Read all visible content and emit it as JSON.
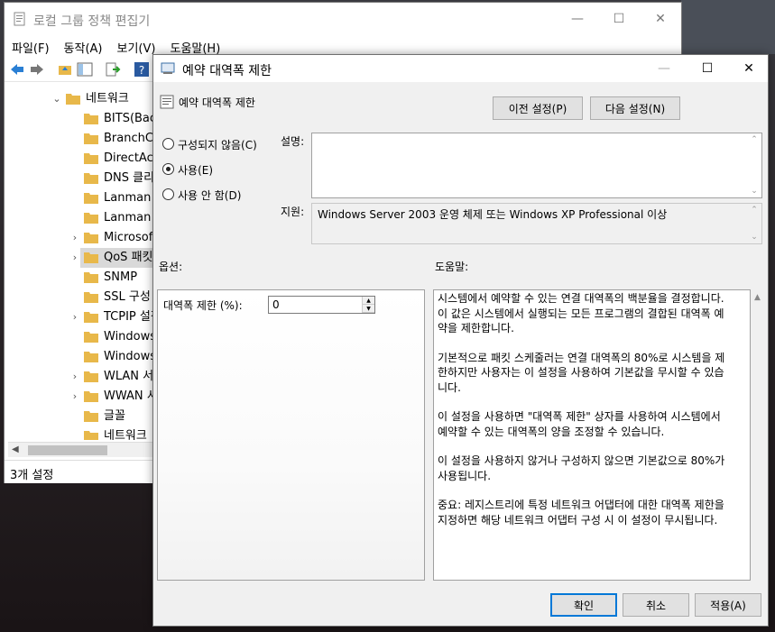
{
  "back_window": {
    "title": "로컬 그룹 정책 편집기",
    "controls": {
      "minimize": "—",
      "maximize": "☐",
      "close": "✕"
    },
    "menu": [
      "파일(F)",
      "동작(A)",
      "보기(V)",
      "도움말(H)"
    ],
    "tree": {
      "root_label": "네트워크",
      "items": [
        {
          "label": "BITS(Back",
          "expandable": false
        },
        {
          "label": "BranchCa",
          "expandable": false
        },
        {
          "label": "DirectAcc",
          "expandable": false
        },
        {
          "label": "DNS 클리",
          "expandable": false
        },
        {
          "label": "Lanman 서",
          "expandable": false
        },
        {
          "label": "Lanman 워",
          "expandable": false
        },
        {
          "label": "Microsoft",
          "expandable": true
        },
        {
          "label": "QoS 패킷",
          "expandable": true,
          "selected": true
        },
        {
          "label": "SNMP",
          "expandable": false
        },
        {
          "label": "SSL 구성",
          "expandable": false
        },
        {
          "label": "TCPIP 설정",
          "expandable": true
        },
        {
          "label": "Windows",
          "expandable": false
        },
        {
          "label": "Windows",
          "expandable": false
        },
        {
          "label": "WLAN 서",
          "expandable": true
        },
        {
          "label": "WWAN 서",
          "expandable": true
        },
        {
          "label": "글꼴",
          "expandable": false
        },
        {
          "label": "네트워크",
          "expandable": false
        }
      ]
    },
    "status": "3개 설정"
  },
  "dialog": {
    "title": "예약 대역폭 제한",
    "controls": {
      "minimize": "—",
      "maximize": "☐",
      "close": "✕"
    },
    "policy_name": "예약 대역폭 제한",
    "prev_button": "이전 설정(P)",
    "next_button": "다음 설정(N)",
    "radios": [
      {
        "label": "구성되지 않음(C)",
        "checked": false
      },
      {
        "label": "사용(E)",
        "checked": true
      },
      {
        "label": "사용 안 함(D)",
        "checked": false
      }
    ],
    "comment_label": "설명:",
    "comment_value": "",
    "supported_label": "지원:",
    "supported_value": "Windows Server 2003 운영 체제 또는 Windows XP Professional 이상",
    "options_label": "옵션:",
    "help_label": "도움말:",
    "option_field_label": "대역폭 제한 (%):",
    "option_field_value": "0",
    "help_paragraphs": [
      "시스템에서 예약할 수 있는 연결 대역폭의 백분율을 결정합니다.\n이 값은 시스템에서 실행되는 모든 프로그램의 결합된 대역폭 예\n약을 제한합니다.",
      "기본적으로 패킷 스케줄러는 연결 대역폭의 80%로 시스템을 제\n한하지만 사용자는 이 설정을 사용하여 기본값을 무시할 수 있습\n니다.",
      "이 설정을 사용하면 \"대역폭 제한\" 상자를 사용하여 시스템에서\n예약할 수 있는 대역폭의 양을 조정할 수 있습니다.",
      "이 설정을 사용하지 않거나 구성하지 않으면 기본값으로 80%가\n사용됩니다.",
      "중요: 레지스트리에 특정 네트워크 어댑터에 대한 대역폭 제한을\n지정하면 해당 네트워크 어댑터 구성 시 이 설정이 무시됩니다."
    ],
    "ok_button": "확인",
    "cancel_button": "취소",
    "apply_button": "적용(A)"
  },
  "colors": {
    "accent": "#0078d7",
    "folder": "#e8b84a"
  }
}
